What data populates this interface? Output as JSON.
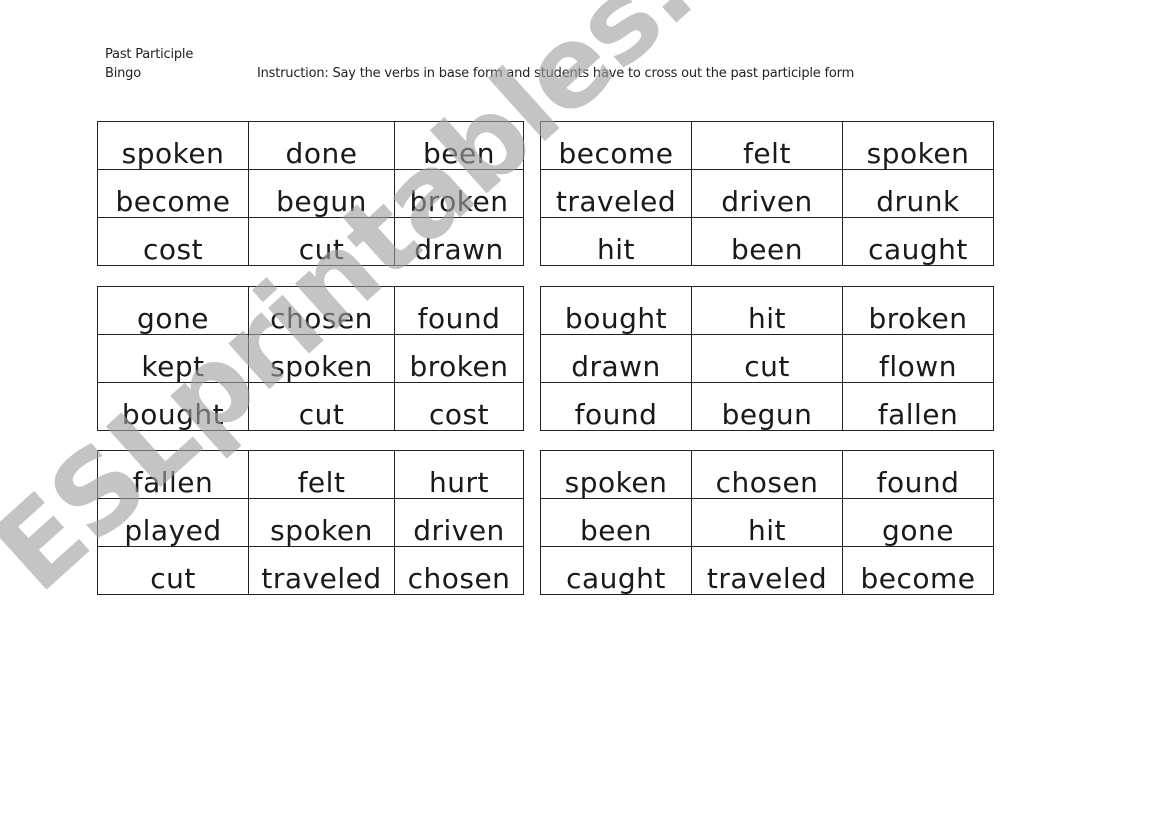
{
  "header": {
    "title_line1": "Past Participle",
    "title_line2": "Bingo",
    "instruction": "Instruction: Say the verbs in base form and students have to cross out the past participle form"
  },
  "cards": [
    {
      "rows": [
        [
          "spoken",
          "done",
          "been"
        ],
        [
          "become",
          "begun",
          "broken"
        ],
        [
          "cost",
          "cut",
          "drawn"
        ]
      ]
    },
    {
      "rows": [
        [
          "become",
          "felt",
          "spoken"
        ],
        [
          "traveled",
          "driven",
          "drunk"
        ],
        [
          "hit",
          "been",
          "caught"
        ]
      ]
    },
    {
      "rows": [
        [
          "gone",
          "chosen",
          "found"
        ],
        [
          "kept",
          "spoken",
          "broken"
        ],
        [
          "bought",
          "cut",
          "cost"
        ]
      ]
    },
    {
      "rows": [
        [
          "bought",
          "hit",
          "broken"
        ],
        [
          "drawn",
          "cut",
          "flown"
        ],
        [
          "found",
          "begun",
          "fallen"
        ]
      ]
    },
    {
      "rows": [
        [
          "fallen",
          "felt",
          "hurt"
        ],
        [
          "played",
          "spoken",
          "driven"
        ],
        [
          "cut",
          "traveled",
          "chosen"
        ]
      ]
    },
    {
      "rows": [
        [
          "spoken",
          "chosen",
          "found"
        ],
        [
          "been",
          "hit",
          "gone"
        ],
        [
          "caught",
          "traveled",
          "become"
        ]
      ]
    }
  ],
  "watermark": {
    "text": "ESLprintables.com",
    "color": "#a0a0a0"
  }
}
